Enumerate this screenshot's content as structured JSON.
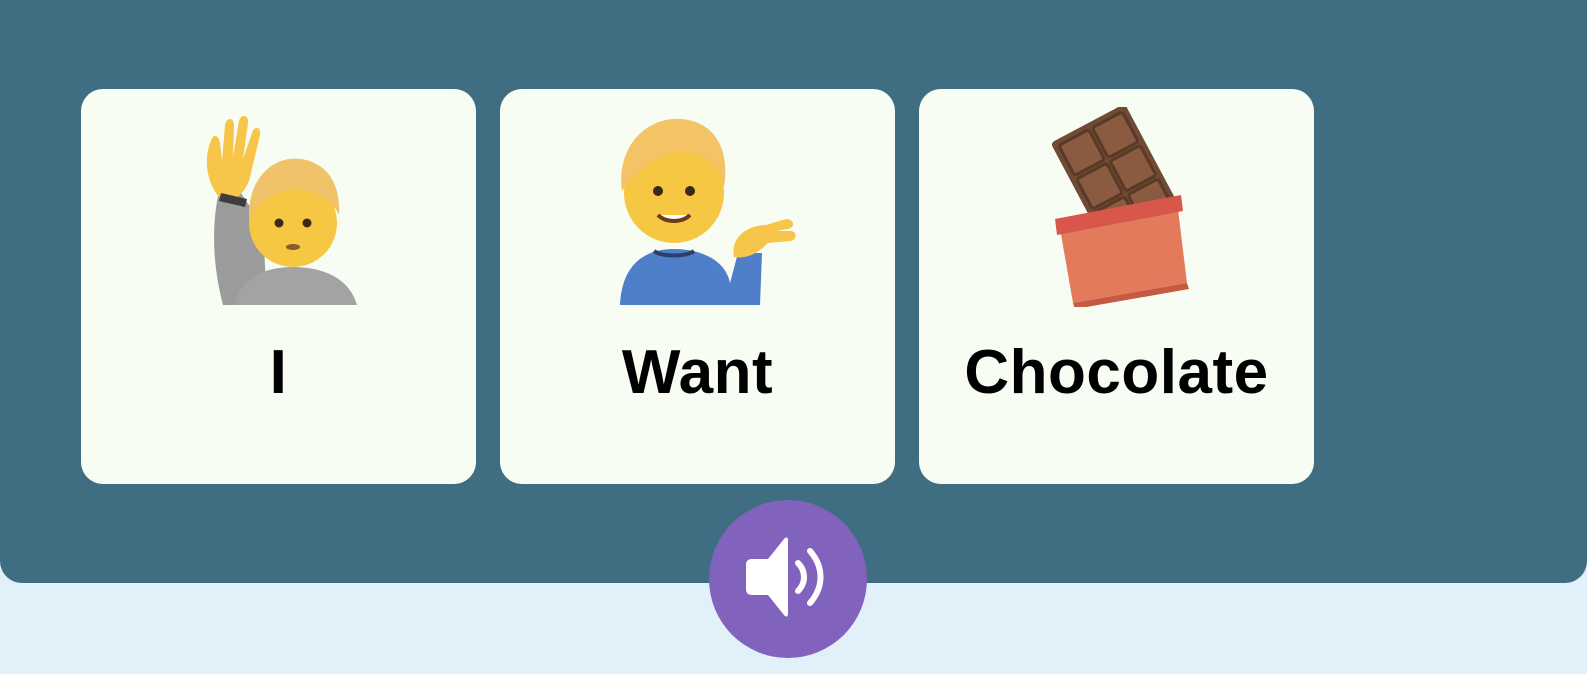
{
  "cards": [
    {
      "label": "I",
      "icon": "person-raising-hand-icon"
    },
    {
      "label": "Want",
      "icon": "person-tipping-hand-icon"
    },
    {
      "label": "Chocolate",
      "icon": "chocolate-bar-icon"
    }
  ],
  "speak_button": {
    "icon": "speaker-icon"
  },
  "colors": {
    "board": "#3f6d82",
    "page_background": "#e2f0f9",
    "card": "#f8fdf3",
    "speak_button": "#8162bd"
  }
}
